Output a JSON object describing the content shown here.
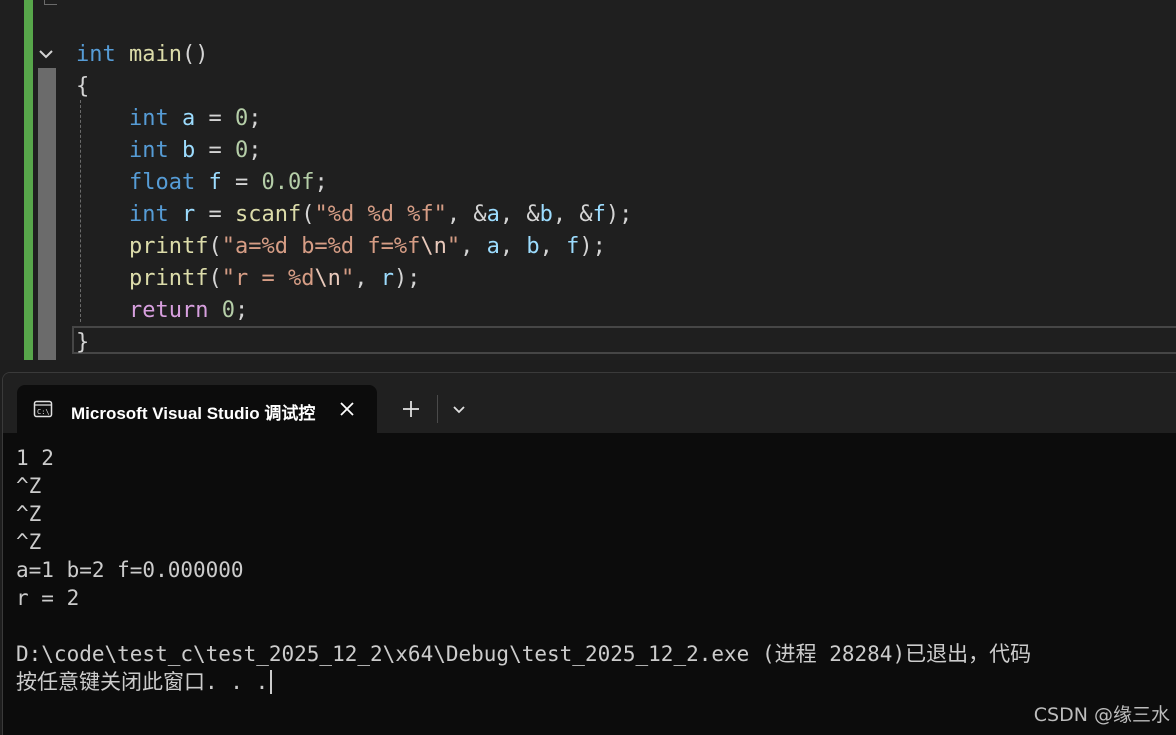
{
  "editor": {
    "lines": [
      [
        {
          "t": "int",
          "c": "kw"
        },
        {
          "t": " ",
          "c": "punc"
        },
        {
          "t": "main",
          "c": "fn"
        },
        {
          "t": "()",
          "c": "punc"
        }
      ],
      [
        {
          "t": "{",
          "c": "punc"
        }
      ],
      [
        {
          "t": "    ",
          "c": "punc"
        },
        {
          "t": "int",
          "c": "kw"
        },
        {
          "t": " ",
          "c": "punc"
        },
        {
          "t": "a",
          "c": "var"
        },
        {
          "t": " = ",
          "c": "punc"
        },
        {
          "t": "0",
          "c": "num"
        },
        {
          "t": ";",
          "c": "punc"
        }
      ],
      [
        {
          "t": "    ",
          "c": "punc"
        },
        {
          "t": "int",
          "c": "kw"
        },
        {
          "t": " ",
          "c": "punc"
        },
        {
          "t": "b",
          "c": "var"
        },
        {
          "t": " = ",
          "c": "punc"
        },
        {
          "t": "0",
          "c": "num"
        },
        {
          "t": ";",
          "c": "punc"
        }
      ],
      [
        {
          "t": "    ",
          "c": "punc"
        },
        {
          "t": "float",
          "c": "kw"
        },
        {
          "t": " ",
          "c": "punc"
        },
        {
          "t": "f",
          "c": "var"
        },
        {
          "t": " = ",
          "c": "punc"
        },
        {
          "t": "0.0f",
          "c": "num"
        },
        {
          "t": ";",
          "c": "punc"
        }
      ],
      [
        {
          "t": "    ",
          "c": "punc"
        },
        {
          "t": "int",
          "c": "kw"
        },
        {
          "t": " ",
          "c": "punc"
        },
        {
          "t": "r",
          "c": "var"
        },
        {
          "t": " = ",
          "c": "punc"
        },
        {
          "t": "scanf",
          "c": "fn"
        },
        {
          "t": "(",
          "c": "punc"
        },
        {
          "t": "\"%d %d %f\"",
          "c": "str"
        },
        {
          "t": ", &",
          "c": "punc"
        },
        {
          "t": "a",
          "c": "var"
        },
        {
          "t": ", &",
          "c": "punc"
        },
        {
          "t": "b",
          "c": "var"
        },
        {
          "t": ", &",
          "c": "punc"
        },
        {
          "t": "f",
          "c": "var"
        },
        {
          "t": ");",
          "c": "punc"
        }
      ],
      [
        {
          "t": "    ",
          "c": "punc"
        },
        {
          "t": "printf",
          "c": "fn"
        },
        {
          "t": "(",
          "c": "punc"
        },
        {
          "t": "\"a=%d b=%d f=%f",
          "c": "str"
        },
        {
          "t": "\\n",
          "c": "esc"
        },
        {
          "t": "\"",
          "c": "str"
        },
        {
          "t": ", ",
          "c": "punc"
        },
        {
          "t": "a",
          "c": "var"
        },
        {
          "t": ", ",
          "c": "punc"
        },
        {
          "t": "b",
          "c": "var"
        },
        {
          "t": ", ",
          "c": "punc"
        },
        {
          "t": "f",
          "c": "var"
        },
        {
          "t": ");",
          "c": "punc"
        }
      ],
      [
        {
          "t": "    ",
          "c": "punc"
        },
        {
          "t": "printf",
          "c": "fn"
        },
        {
          "t": "(",
          "c": "punc"
        },
        {
          "t": "\"r = %d",
          "c": "str"
        },
        {
          "t": "\\n",
          "c": "esc"
        },
        {
          "t": "\"",
          "c": "str"
        },
        {
          "t": ", ",
          "c": "punc"
        },
        {
          "t": "r",
          "c": "var"
        },
        {
          "t": ");",
          "c": "punc"
        }
      ],
      [
        {
          "t": "    ",
          "c": "punc"
        },
        {
          "t": "return",
          "c": "ctl"
        },
        {
          "t": " ",
          "c": "punc"
        },
        {
          "t": "0",
          "c": "num"
        },
        {
          "t": ";",
          "c": "punc"
        }
      ],
      [
        {
          "t": "}",
          "c": "punc"
        }
      ]
    ],
    "colors": {
      "background": "#1f1f1f",
      "changed_margin": "#57a64a",
      "keyword": "#569cd6",
      "control": "#d8a0df",
      "function": "#dcdcaa",
      "variable": "#9cdcfe",
      "number": "#b5cea8",
      "string": "#d69d85"
    }
  },
  "terminal": {
    "tab": {
      "icon": "console-icon",
      "title": "Microsoft Visual Studio 调试控",
      "close_icon": "close-icon"
    },
    "new_tab_icon": "plus-icon",
    "dropdown_icon": "chevron-down-icon",
    "output": [
      "1 2",
      "^Z",
      "^Z",
      "^Z",
      "a=1 b=2 f=0.000000",
      "r = 2",
      "",
      "D:\\code\\test_c\\test_2025_12_2\\x64\\Debug\\test_2025_12_2.exe (进程 28284)已退出，代码",
      "按任意键关闭此窗口. . ."
    ]
  },
  "watermark": "CSDN @缘三水"
}
